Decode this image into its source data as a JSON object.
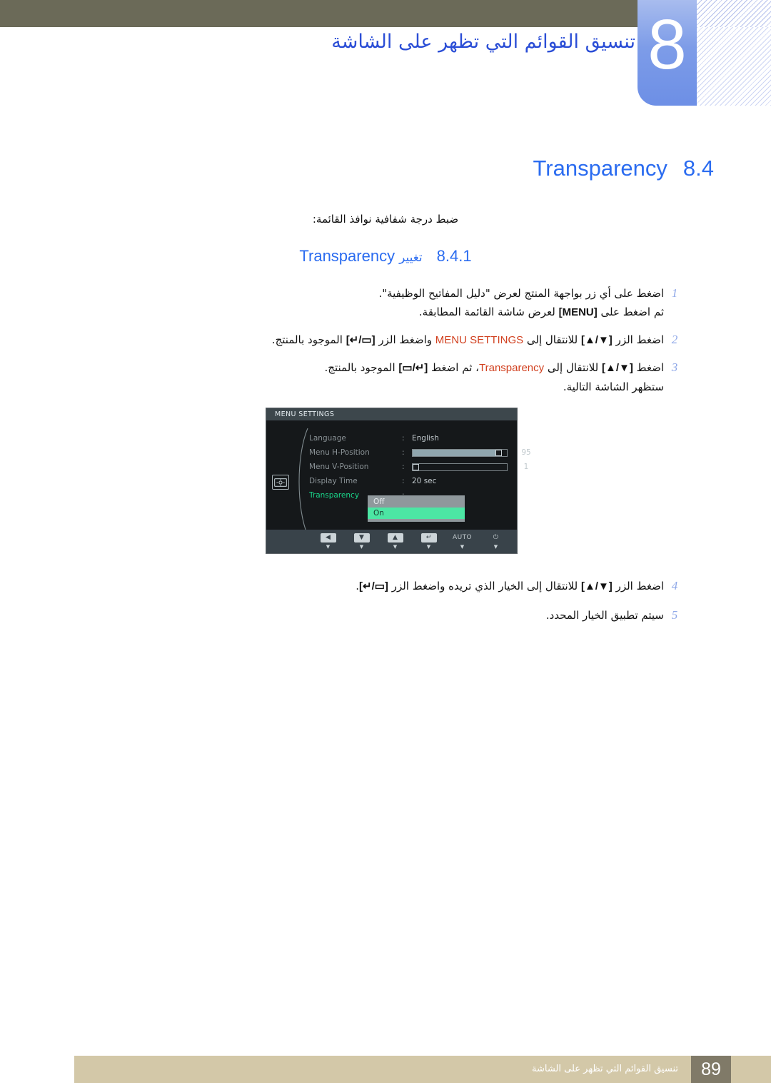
{
  "header": {
    "chapter_number": "8",
    "chapter_title": "تنسيق القوائم التي تظهر على الشاشة",
    "olive_bar_color": "#6b6a58",
    "chapter_block_color": "#7d9ce8"
  },
  "section": {
    "number": "8.4",
    "title_en": "Transparency",
    "description": "ضبط درجة شفافية نوافذ القائمة:",
    "accent_color": "#2b6cf0"
  },
  "subsection": {
    "number": "8.4.1",
    "label_ar": "تغيير",
    "label_en": "Transparency"
  },
  "steps": [
    {
      "num": "1",
      "line1_a": "اضغط على أي زر بواجهة المنتج لعرض \"دليل المفاتيح الوظيفية\".",
      "line2_a": "ثم اضغط على ",
      "line2_kbd": "[MENU]",
      "line2_b": " لعرض شاشة القائمة المطابقة."
    },
    {
      "num": "2",
      "line1_a": "اضغط الزر ",
      "line1_kbd1": "[▲/▼]",
      "line1_b": " للانتقال إلى ",
      "line1_hl": "MENU SETTINGS",
      "line1_c": " واضغط الزر ",
      "line1_kbd2": "[↵/▭]",
      "line1_d": " الموجود بالمنتج."
    },
    {
      "num": "3",
      "line1_a": "اضغط ",
      "line1_kbd1": "[▲/▼]",
      "line1_b": " للانتقال إلى ",
      "line1_hl": "Transparency",
      "line1_c": "، ثم اضغط ",
      "line1_kbd2": "[▭/↵]",
      "line1_d": " الموجود بالمنتج.",
      "line2": "ستظهر الشاشة التالية."
    },
    {
      "num": "4",
      "line1_a": "اضغط الزر ",
      "line1_kbd1": "[▲/▼]",
      "line1_b": " للانتقال إلى الخيار الذي تريده واضغط الزر ",
      "line1_kbd2": "[↵/▭]",
      "line1_d": "."
    },
    {
      "num": "5",
      "line1_a": "سيتم تطبيق الخيار المحدد."
    }
  ],
  "osd": {
    "title": "MENU SETTINGS",
    "rows": [
      {
        "label": "Language",
        "colon": ":",
        "value": "English",
        "num": ""
      },
      {
        "label": "Menu H-Position",
        "colon": ":",
        "value": "",
        "num": "95",
        "bar": 95
      },
      {
        "label": "Menu V-Position",
        "colon": ":",
        "value": "",
        "num": "1",
        "bar": 1
      },
      {
        "label": "Display Time",
        "colon": ":",
        "value": "20 sec",
        "num": ""
      },
      {
        "label": "Transparency",
        "colon": ":",
        "value": "",
        "num": "",
        "active": true
      }
    ],
    "dropdown_options": [
      "Off",
      "On"
    ],
    "dropdown_selected": "On",
    "highlight_color": "#4ce6a4",
    "active_label_color": "#19d68a",
    "buttons": [
      {
        "name": "left",
        "glyph": "◀"
      },
      {
        "name": "down",
        "glyph": "▼"
      },
      {
        "name": "up",
        "glyph": "▲"
      },
      {
        "name": "enter",
        "glyph": "↵"
      },
      {
        "name": "auto",
        "glyph": "AUTO"
      },
      {
        "name": "power",
        "glyph": "⏻"
      }
    ]
  },
  "footer": {
    "text": "تنسيق القوائم التي تظهر على الشاشة",
    "page": "89",
    "bar_color": "#d3c8a8",
    "page_box_color": "#807a68"
  }
}
